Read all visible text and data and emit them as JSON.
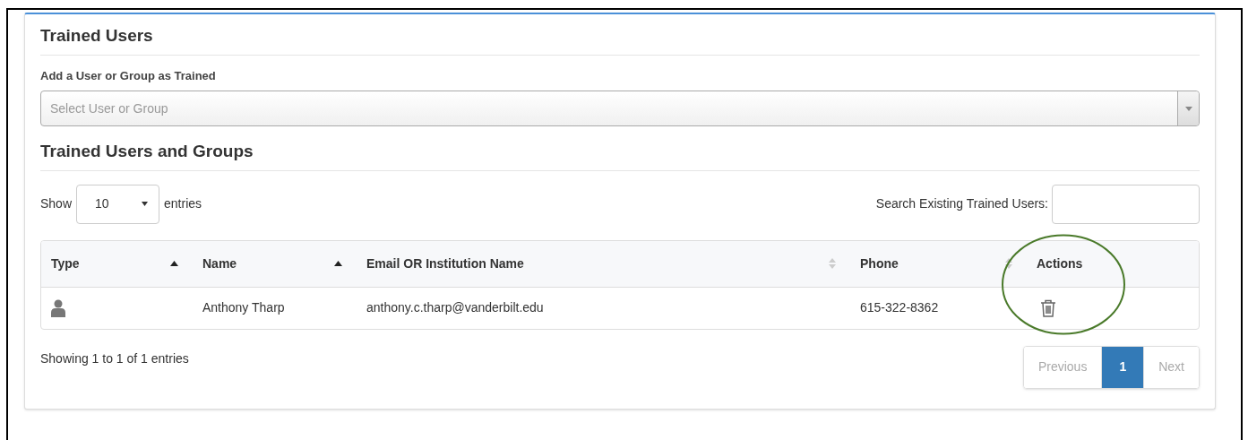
{
  "panel": {
    "title": "Trained Users"
  },
  "add_field": {
    "label": "Add a User or Group as Trained",
    "placeholder": "Select User or Group"
  },
  "section_title": "Trained Users and Groups",
  "length_control": {
    "prefix": "Show",
    "value": "10",
    "suffix": "entries"
  },
  "search": {
    "label": "Search Existing Trained Users:"
  },
  "table": {
    "columns": [
      {
        "label": "Type",
        "kind": "sorted-ascending"
      },
      {
        "label": "Name",
        "kind": "sorted-ascending"
      },
      {
        "label": "Email OR Institution Name",
        "kind": "sortable"
      },
      {
        "label": "Phone",
        "kind": "sortable"
      },
      {
        "label": "Actions",
        "kind": "plain"
      }
    ],
    "rows": [
      {
        "kind": "user",
        "name": "Anthony Tharp",
        "email": "anthony.c.tharp@vanderbilt.edu",
        "phone": "615-322-8362",
        "actions": [
          {
            "kind": "delete"
          }
        ]
      }
    ]
  },
  "info": "Showing 1 to 1 of 1 entries",
  "pagination": [
    {
      "label": "Previous",
      "selected": false,
      "disabled": true
    },
    {
      "label": "1",
      "selected": true,
      "disabled": false
    },
    {
      "label": "Next",
      "selected": false,
      "disabled": true
    }
  ],
  "annotation": {
    "kind": "circle",
    "color": "#4a7a2a"
  }
}
